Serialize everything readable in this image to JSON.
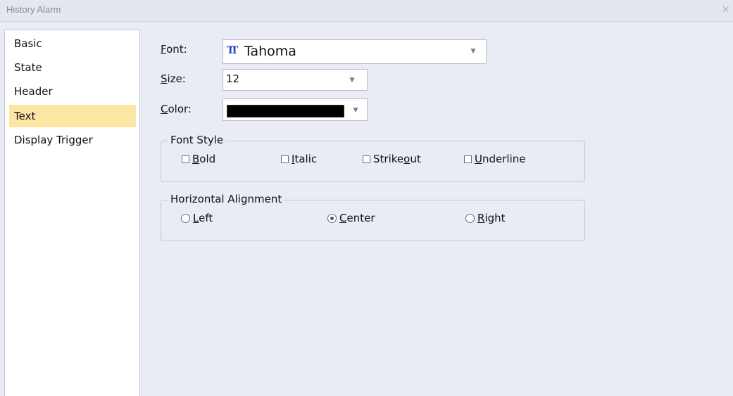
{
  "window": {
    "title": "History Alarm",
    "close_glyph": "×"
  },
  "sidebar": {
    "items": [
      {
        "label": "Basic",
        "selected": false
      },
      {
        "label": "State",
        "selected": false
      },
      {
        "label": "Header",
        "selected": false
      },
      {
        "label": "Text",
        "selected": true
      },
      {
        "label": "Display Trigger",
        "selected": false
      }
    ],
    "selected_color": "#fde5a3"
  },
  "font": {
    "label_key": "F",
    "label_rest": "ont:",
    "icon": "font-truetype-icon",
    "icon_glyph": "TT",
    "value": "Tahoma"
  },
  "size": {
    "label_key": "S",
    "label_rest": "ize:",
    "value": "12"
  },
  "color": {
    "label_key": "C",
    "label_rest": "olor:",
    "value": "#000000"
  },
  "font_style": {
    "legend": "Font Style",
    "bold": {
      "key": "B",
      "rest": "old",
      "checked": false
    },
    "italic": {
      "key": "I",
      "rest": "talic",
      "checked": false
    },
    "strikeout": {
      "pre": "Strike",
      "key": "o",
      "rest": "ut",
      "checked": false
    },
    "underline": {
      "key": "U",
      "rest": "nderline",
      "checked": false
    }
  },
  "horizontal_alignment": {
    "legend": "Horizontal Alignment",
    "left": {
      "key": "L",
      "rest": "eft"
    },
    "center": {
      "key": "C",
      "rest": "enter"
    },
    "right": {
      "key": "R",
      "rest": "ight"
    },
    "selected": "center"
  },
  "colors": {
    "background": "#e9ecf5",
    "icon_blue": "#1f43b8"
  }
}
